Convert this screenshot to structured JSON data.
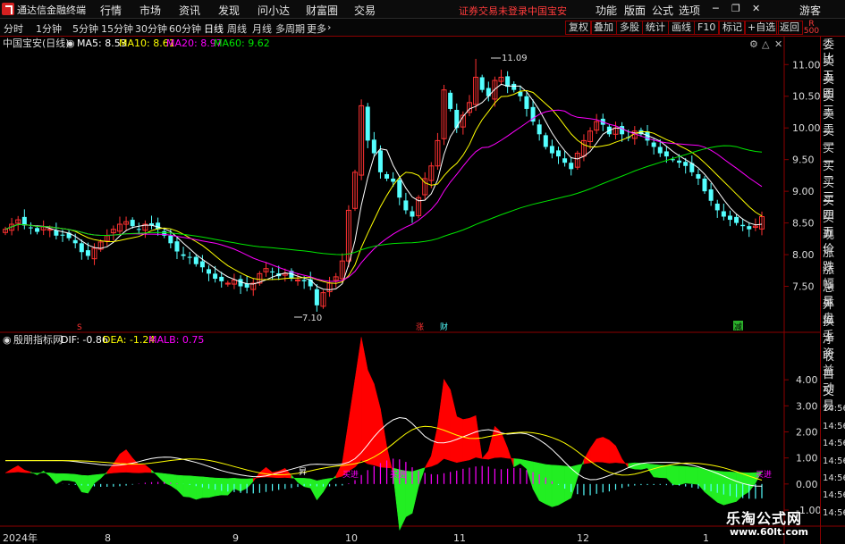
{
  "app": {
    "title": "通达信金融终端",
    "menu": [
      "行情",
      "市场",
      "资讯",
      "发现",
      "问小达",
      "财富圈",
      "交易"
    ],
    "login_warning": "证券交易未登录",
    "login_stock": "中国宝安",
    "right_menu": [
      "功能",
      "版面",
      "公式",
      "选项"
    ],
    "user": "游客"
  },
  "periods": {
    "items": [
      "分时",
      "1分钟",
      "5分钟",
      "15分钟",
      "30分钟",
      "60分钟",
      "日线",
      "周线",
      "月线",
      "多周期",
      "更多"
    ],
    "active": "日线"
  },
  "toolbar": {
    "buttons": [
      "复权",
      "叠加",
      "多股",
      "统计",
      "画线",
      "F10",
      "标记",
      "+自选",
      "返回"
    ]
  },
  "right_panel": {
    "ratio_label": "R",
    "ratio_value": "500",
    "items": [
      "委比",
      "卖五",
      "卖四",
      "卖三",
      "卖二",
      "卖一",
      "买一",
      "买二",
      "买三",
      "买四",
      "买五",
      "现价",
      "涨跌",
      "涨幅",
      "总量",
      "外盘",
      "换手",
      "净资",
      "收益",
      "自动",
      "交易",
      "14:56",
      "14:56",
      "14:56",
      "14:56",
      "14:56",
      "14:56",
      "14:56"
    ]
  },
  "main_legend": {
    "name": "中国宝安(日线)",
    "ma5": "MA5: 8.53",
    "ma10": "MA10: 8.61",
    "ma20": "MA20: 8.97",
    "ma60": "MA60: 9.62"
  },
  "price_axis": {
    "ticks": [
      "11.00",
      "10.50",
      "10.00",
      "9.50",
      "9.00",
      "8.50",
      "8.00",
      "7.50"
    ]
  },
  "annotations": {
    "high_label": "11.09",
    "low_label": "7.10",
    "markers": [
      "S",
      "涨",
      "财",
      "减"
    ]
  },
  "indicator": {
    "name": "殷朋指标网",
    "dif": "DIF: -0.86",
    "dea": "DEA: -1.24",
    "malb": "MALB: 0.75",
    "ticks": [
      "4.00",
      "3.00",
      "2.00",
      "1.00",
      "0.00",
      "-1.00"
    ],
    "buy_labels": [
      "昇",
      "买进",
      "买进",
      "买进"
    ]
  },
  "date_axis": {
    "labels": [
      "2024年",
      "8",
      "9",
      "10",
      "11",
      "12",
      "1"
    ]
  },
  "colors": {
    "up": "#ff3232",
    "down": "#54ffff",
    "ma5": "#ffffff",
    "ma10": "#ffff00",
    "ma20": "#ff00ff",
    "ma60": "#00e600",
    "grid": "#8b0000",
    "hist_pos": "#ff00ff",
    "hist_neg": "#54ffff"
  },
  "watermark": {
    "line1": "乐淘公式网",
    "line2": "www.60lt.com"
  },
  "chart_data": {
    "type": "candlestick",
    "title": "中国宝安(日线)",
    "ylim": [
      7.0,
      11.3
    ],
    "y_ticks": [
      7.5,
      8.0,
      8.5,
      9.0,
      9.5,
      10.0,
      10.5,
      11.0
    ],
    "x_month_labels": [
      "2024年",
      "8",
      "9",
      "10",
      "11",
      "12",
      "1"
    ],
    "period_high": 11.09,
    "period_low": 7.1,
    "close": [
      8.4,
      8.48,
      8.55,
      8.46,
      8.42,
      8.36,
      8.44,
      8.4,
      8.3,
      8.3,
      8.26,
      8.18,
      8.04,
      7.98,
      8.1,
      8.2,
      8.3,
      8.4,
      8.48,
      8.52,
      8.45,
      8.4,
      8.48,
      8.46,
      8.4,
      8.3,
      8.18,
      8.05,
      7.98,
      7.95,
      7.85,
      7.8,
      7.7,
      7.62,
      7.58,
      7.55,
      7.6,
      7.5,
      7.48,
      7.55,
      7.7,
      7.78,
      7.72,
      7.66,
      7.7,
      7.62,
      7.6,
      7.58,
      7.5,
      7.2,
      7.4,
      7.55,
      7.65,
      7.9,
      8.7,
      9.3,
      10.35,
      9.8,
      9.6,
      9.3,
      9.2,
      9.15,
      8.9,
      8.7,
      8.6,
      8.9,
      9.2,
      9.4,
      9.8,
      10.6,
      10.3,
      10.0,
      10.2,
      10.4,
      10.8,
      10.6,
      10.5,
      10.75,
      10.8,
      10.65,
      10.6,
      10.5,
      10.3,
      10.1,
      9.9,
      9.7,
      9.6,
      9.55,
      9.45,
      9.35,
      9.6,
      9.8,
      9.95,
      10.1,
      10.05,
      9.9,
      10.0,
      9.9,
      9.85,
      9.95,
      9.9,
      9.8,
      9.7,
      9.6,
      9.55,
      9.5,
      9.45,
      9.4,
      9.3,
      9.2,
      9.0,
      8.85,
      8.7,
      8.6,
      8.55,
      8.5,
      8.45,
      8.4,
      8.45,
      8.6
    ],
    "ma5_last": 8.53,
    "ma10_last": 8.61,
    "ma20_last": 8.97,
    "ma60_last": 9.62,
    "indicator": {
      "name": "殷朋指标网",
      "ylim": [
        -1.0,
        5.0
      ],
      "dif_last": -0.86,
      "dea_last": -1.24,
      "malb_last": 0.75
    }
  }
}
